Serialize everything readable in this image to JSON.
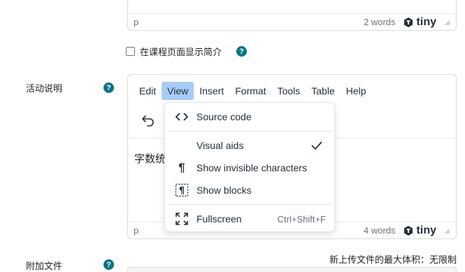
{
  "top_editor": {
    "path": "p",
    "word_count": "2 words",
    "brand": "tiny"
  },
  "show_description": {
    "label": "在课程页面显示简介",
    "checked": false
  },
  "activity": {
    "label": "活动说明"
  },
  "menubar": [
    {
      "label": "Edit",
      "active": false
    },
    {
      "label": "View",
      "active": true
    },
    {
      "label": "Insert",
      "active": false
    },
    {
      "label": "Format",
      "active": false
    },
    {
      "label": "Tools",
      "active": false
    },
    {
      "label": "Table",
      "active": false
    },
    {
      "label": "Help",
      "active": false
    }
  ],
  "editor_content": "字数统",
  "view_menu": {
    "items": [
      {
        "label": "Source code",
        "icon": "source-code-icon",
        "shortcut": "",
        "checked": false
      },
      {
        "label": "Visual aids",
        "icon": "",
        "shortcut": "",
        "checked": true
      },
      {
        "label": "Show invisible characters",
        "icon": "pilcrow-icon",
        "shortcut": "",
        "checked": false
      },
      {
        "label": "Show blocks",
        "icon": "show-blocks-icon",
        "shortcut": "",
        "checked": false
      },
      {
        "label": "Fullscreen",
        "icon": "fullscreen-icon",
        "shortcut": "Ctrl+Shift+F",
        "checked": false
      }
    ]
  },
  "bottom_editor": {
    "path": "p",
    "word_count": "4 words",
    "brand": "tiny"
  },
  "attachments": {
    "label": "附加文件",
    "max_size": "新上传文件的最大体积：无限制"
  },
  "colors": {
    "help_icon": "#0b7285",
    "menu_active": "#a6ccf7",
    "border": "#d7dbe0"
  }
}
